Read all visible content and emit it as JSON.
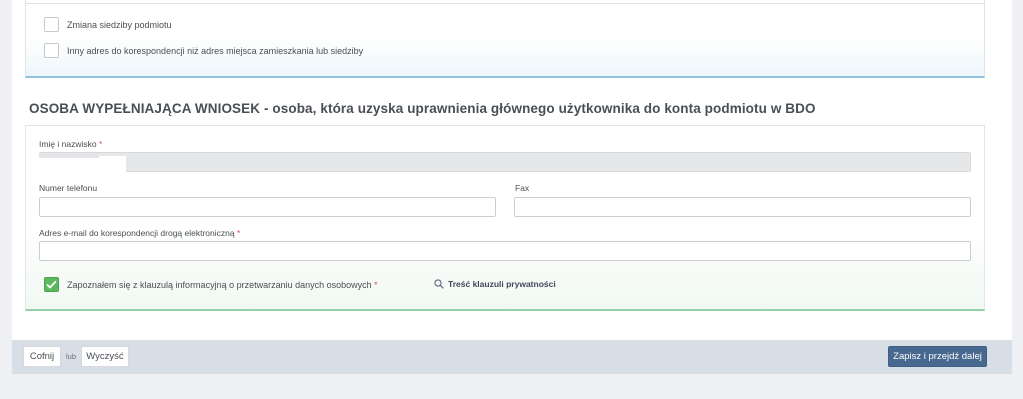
{
  "checkboxes_top": [
    {
      "label": "Zmiana siedziby podmiotu",
      "checked": false
    },
    {
      "label": "Inny adres do korespondencji niż adres miejsca zamieszkania lub siedziby",
      "checked": false
    }
  ],
  "section": {
    "title": "OSOBA WYPEŁNIAJĄCA WNIOSEK - osoba, która uzyska uprawnienia głównego użytkownika do konta podmiotu w BDO"
  },
  "form": {
    "name": {
      "label": "Imię i nazwisko",
      "required_mark": "*",
      "value": ""
    },
    "phone": {
      "label": "Numer telefonu",
      "value": ""
    },
    "fax": {
      "label": "Fax",
      "value": ""
    },
    "email": {
      "label": "Adres e-mail do korespondencji drogą elektroniczną",
      "required_mark": "*",
      "value": ""
    },
    "consent": {
      "label": "Zapoznałem się z klauzulą informacyjną o przetwarzaniu danych osobowych",
      "required_mark": "*",
      "checked": true
    },
    "privacy_link": "Treść klauzuli prywatności"
  },
  "footer": {
    "back_label": "Cofnij",
    "or_text": "lub",
    "clear_label": "Wyczyść",
    "submit_label": "Zapisz i przejdź dalej"
  },
  "colors": {
    "accent_blue": "#8fc3dd",
    "accent_green": "#8fd3a6",
    "checkbox_checked": "#5cb85c",
    "primary_button": "#47698f"
  }
}
